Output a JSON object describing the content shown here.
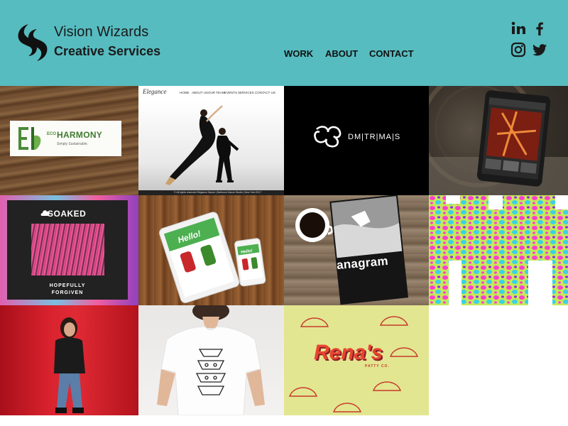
{
  "header": {
    "brand_line1": "Vision Wizards",
    "brand_line2": "Creative Services",
    "nav": {
      "work": "WORK",
      "about": "ABOUT",
      "contact": "CONTACT"
    },
    "social": [
      "linkedin-icon",
      "facebook-icon",
      "instagram-icon",
      "twitter-icon"
    ]
  },
  "colors": {
    "header_bg": "#56bcc0",
    "text": "#111111"
  },
  "portfolio": {
    "eco": {
      "prefix": "ECO",
      "name": "HARMONY",
      "tagline": "Simply Sustainable."
    },
    "dance": {
      "logo": "Elegance",
      "nav": [
        "HOME",
        "ABOUT US",
        "OUR TEAM",
        "EVENTS",
        "SERVICES",
        "CONTACT US"
      ],
      "footer": "© All rights reserved Elegance Dance | Ballroom Dance Studio | New York 2017"
    },
    "dmitrimais": {
      "text": "DM|TR|MA|S"
    },
    "soaked": {
      "title": "SOAKED",
      "sub1": "HOPEFULLY",
      "sub2": "FORGIVEN"
    },
    "hello": {
      "text": "Hello!"
    },
    "anagram": {
      "text": "anagram"
    },
    "renas": {
      "title": "Rena's",
      "sub": "PATTY CO."
    }
  }
}
